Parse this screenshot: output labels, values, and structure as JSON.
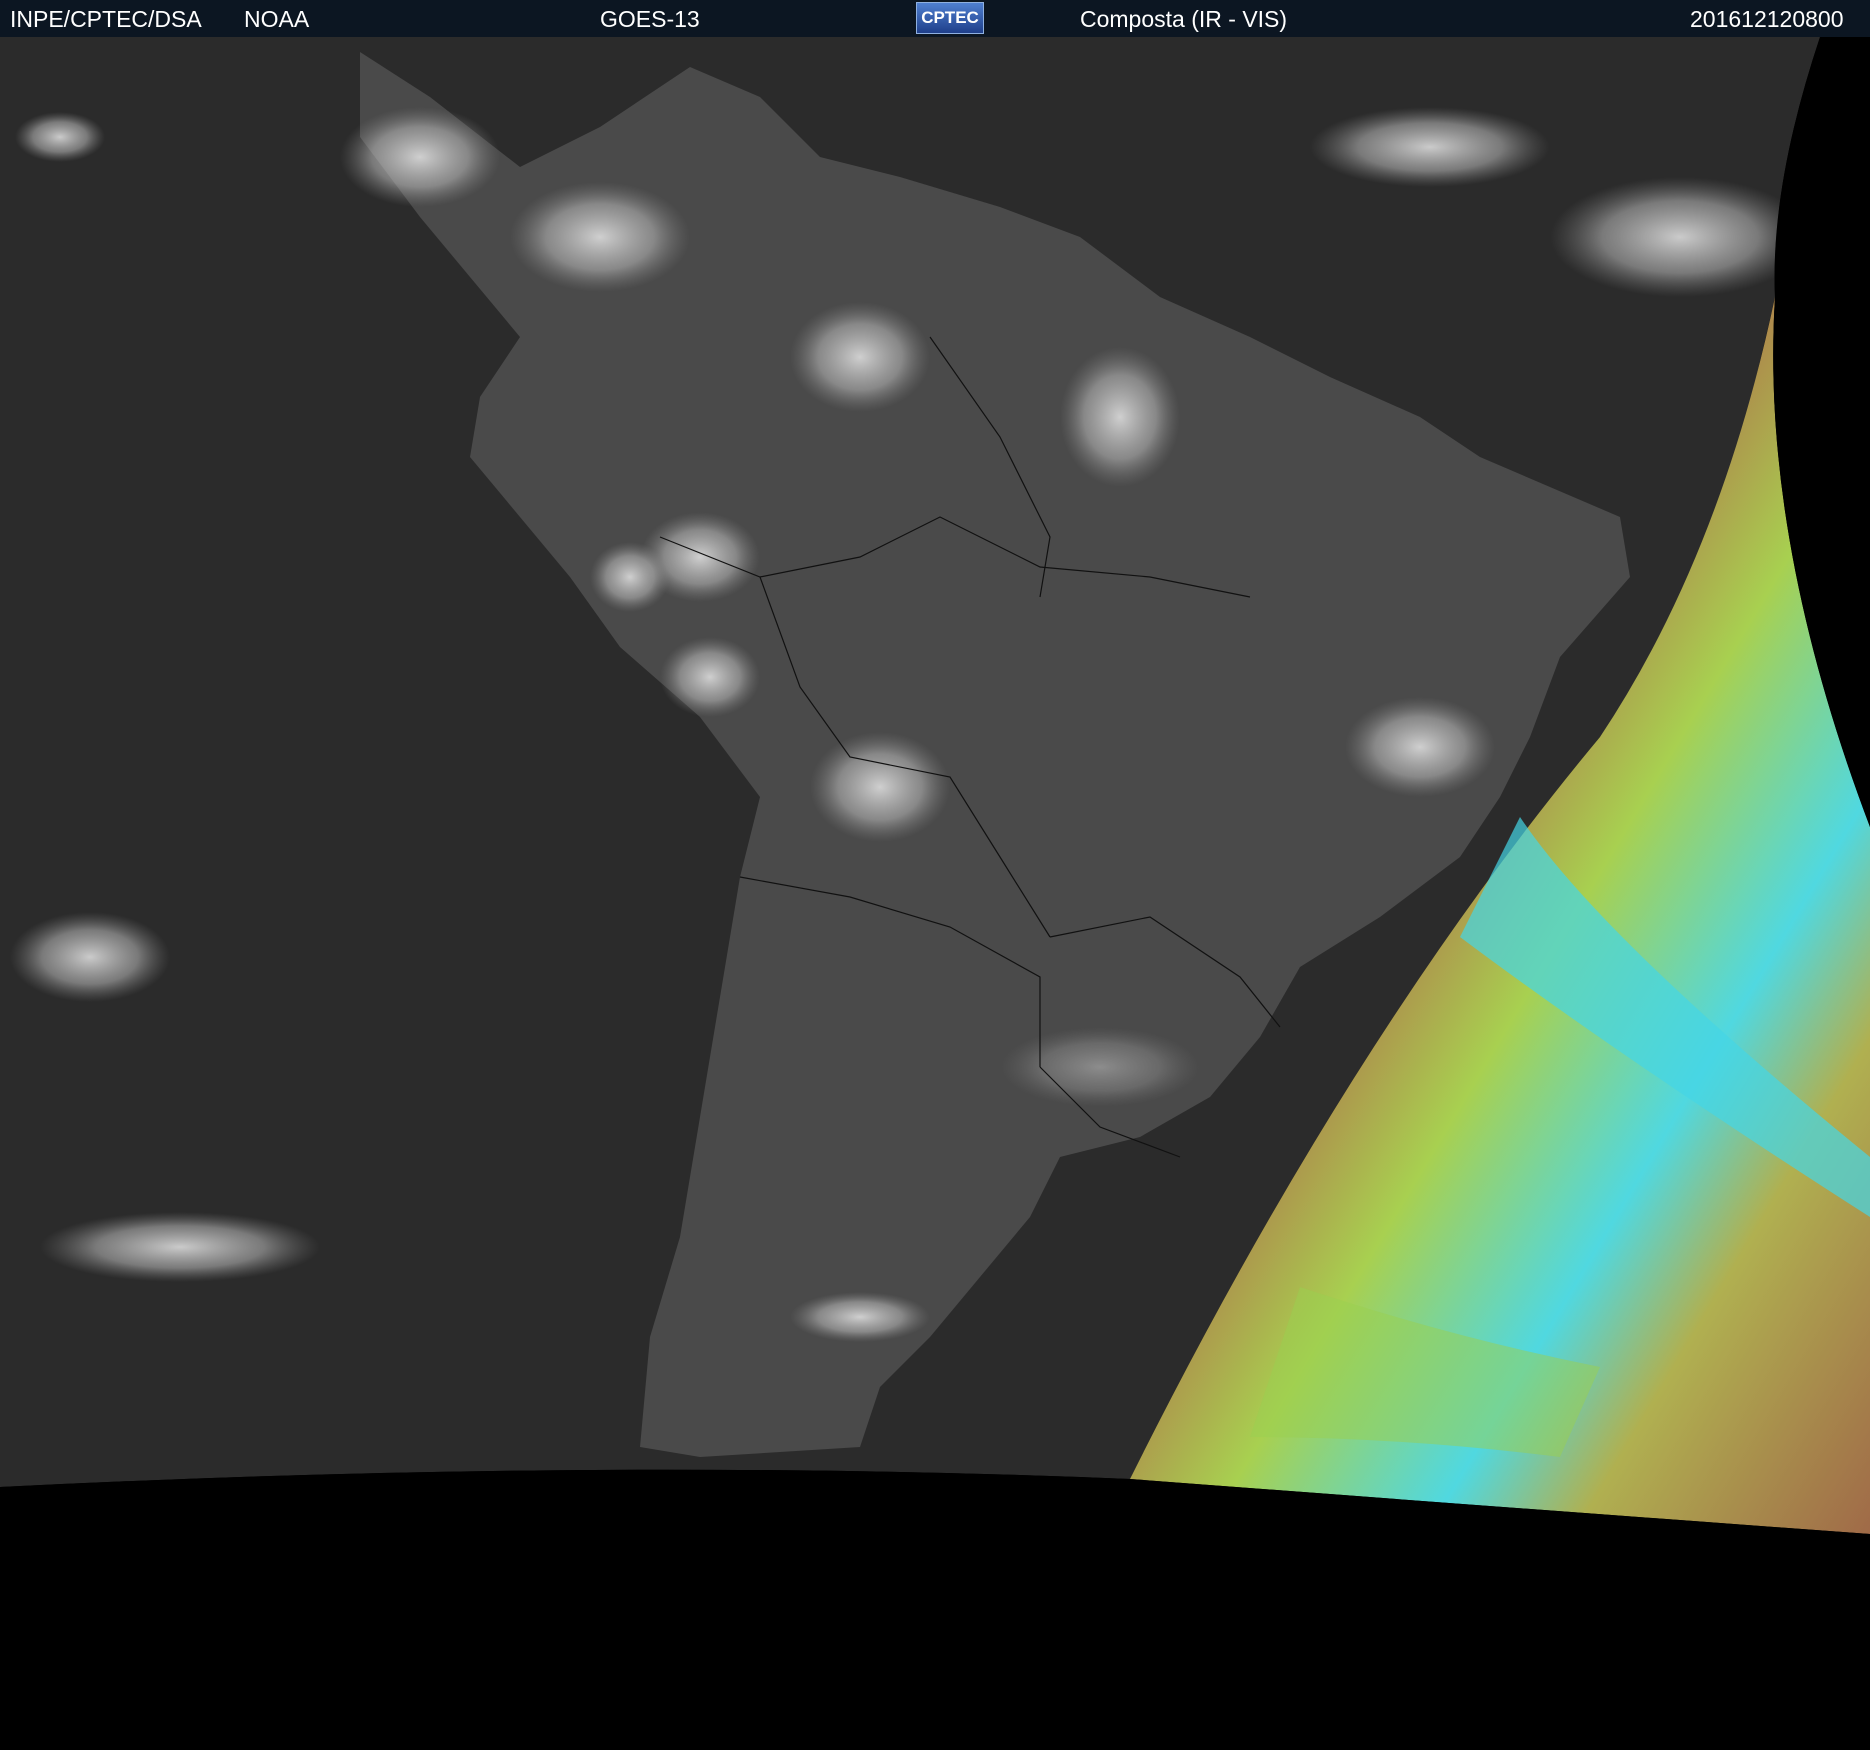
{
  "header": {
    "org": "INPE/CPTEC/DSA",
    "agency": "NOAA",
    "satellite": "GOES-13",
    "logo_text": "CPTEC",
    "product": "Composta (IR - VIS)",
    "timestamp": "201612120800"
  },
  "colors": {
    "header_bg": "#0c1622",
    "ocean": "#2a2a2a",
    "land": "#4a4a4a",
    "cloud": "#d8d8d8",
    "vis_day_side": "#b07048",
    "vis_green": "#9ccf4a",
    "vis_cyan": "#40d8e8",
    "space": "#000000"
  }
}
